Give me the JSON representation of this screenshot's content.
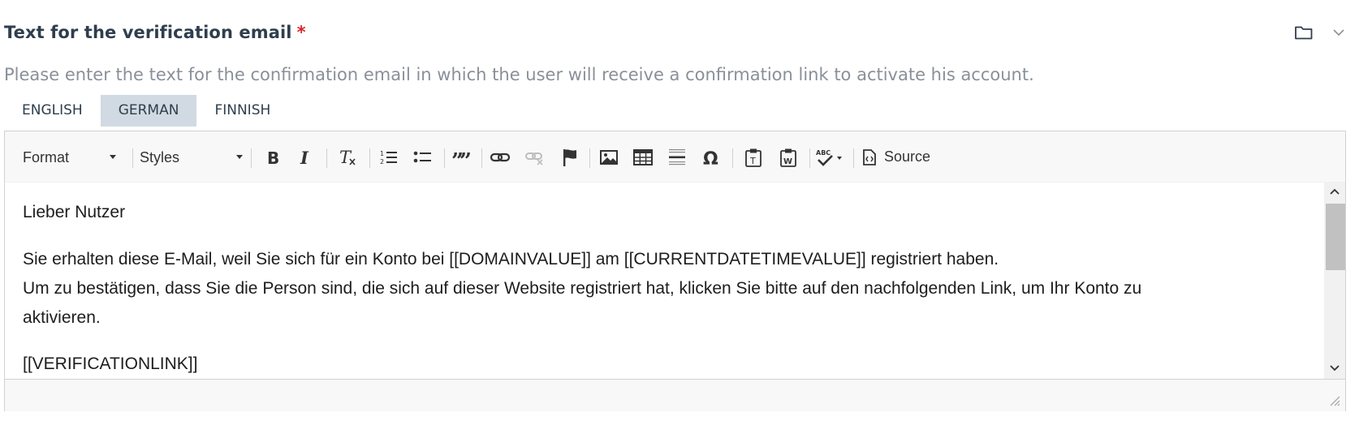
{
  "field": {
    "title": "Text for the verification email",
    "required_mark": "*",
    "description": "Please enter the text for the confirmation email in which the user will receive a confirmation link to activate his account."
  },
  "tabs": [
    {
      "label": "ENGLISH",
      "active": false
    },
    {
      "label": "GERMAN",
      "active": true
    },
    {
      "label": "FINNISH",
      "active": false
    }
  ],
  "toolbar": {
    "format_label": "Format",
    "styles_label": "Styles",
    "source_label": "Source",
    "icons": [
      "bold-icon",
      "italic-icon",
      "remove-format-icon",
      "numbered-list-icon",
      "bulleted-list-icon",
      "blockquote-icon",
      "link-icon",
      "unlink-icon",
      "anchor-icon",
      "image-icon",
      "table-icon",
      "horizontal-line-icon",
      "special-char-icon",
      "paste-text-icon",
      "paste-word-icon",
      "spellcheck-icon",
      "source-icon"
    ]
  },
  "content": {
    "greeting": "Lieber Nutzer",
    "line1": "Sie erhalten diese E-Mail, weil Sie sich für ein Konto bei [[DOMAINVALUE]] am [[CURRENTDATETIMEVALUE]] registriert haben.",
    "line2": "Um zu bestätigen, dass Sie die Person sind, die sich auf dieser Website registriert hat, klicken Sie bitte auf den nachfolgenden Link, um Ihr Konto zu",
    "line3": "aktivieren.",
    "link_placeholder": "[[VERIFICATIONLINK]]"
  },
  "colors": {
    "title": "#2f3e4e",
    "required": "#d9262c",
    "description": "#8a9099",
    "active_tab": "#d1dae2",
    "toolbar_bg": "#f8f8f8"
  }
}
